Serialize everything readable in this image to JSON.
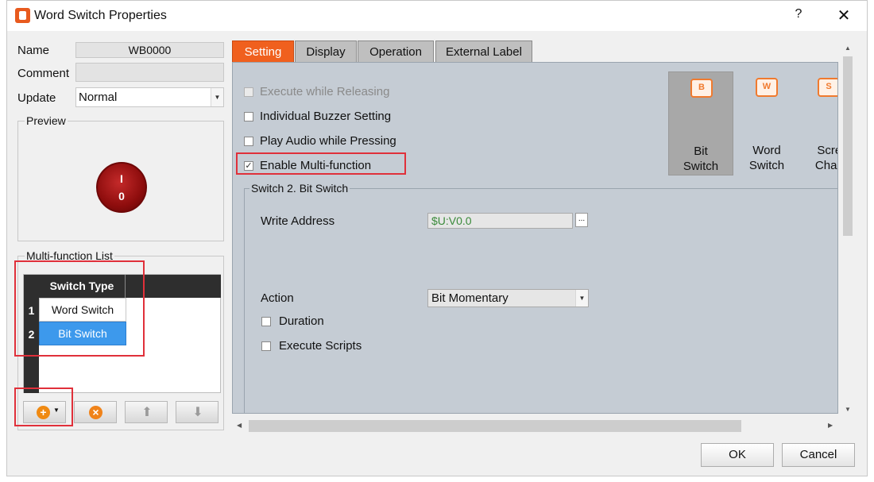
{
  "window": {
    "title": "Word Switch Properties",
    "help": "?",
    "close": "✕"
  },
  "left": {
    "name_label": "Name",
    "name_value": "WB0000",
    "comment_label": "Comment",
    "comment_value": "",
    "update_label": "Update",
    "update_value": "Normal",
    "preview_label": "Preview",
    "preview_knob_top": "I",
    "preview_knob_bottom": "0",
    "mf_label": "Multi-function List",
    "mf_column": "Switch Type",
    "mf_rows": [
      {
        "num": "1",
        "type": "Word Switch"
      },
      {
        "num": "2",
        "type": "Bit Switch"
      }
    ]
  },
  "tabs": [
    "Setting",
    "Display",
    "Operation",
    "External Label"
  ],
  "setting": {
    "execute_releasing": "Execute while Releasing",
    "individual_buzzer": "Individual Buzzer Setting",
    "play_audio": "Play Audio while Pressing",
    "enable_multi": "Enable Multi-function",
    "enable_multi_checked": true,
    "switch_types": [
      {
        "icon": "B",
        "line1": "Bit",
        "line2": "Switch"
      },
      {
        "icon": "W",
        "line1": "Word",
        "line2": "Switch"
      },
      {
        "icon": "S",
        "line1": "Scree",
        "line2": "Chang"
      }
    ],
    "section_title": "Switch 2. Bit Switch",
    "write_address_label": "Write Address",
    "write_address_value": "$U:V0.0",
    "addr_btn": "...",
    "action_label": "Action",
    "action_value": "Bit Momentary",
    "duration": "Duration",
    "execute_scripts": "Execute Scripts"
  },
  "buttons": {
    "ok": "OK",
    "cancel": "Cancel"
  },
  "colors": {
    "active_tab": "#f0601e",
    "selected_row": "#3d99ec",
    "highlight_box": "#e0303a",
    "address_text": "#3a8a3a"
  }
}
